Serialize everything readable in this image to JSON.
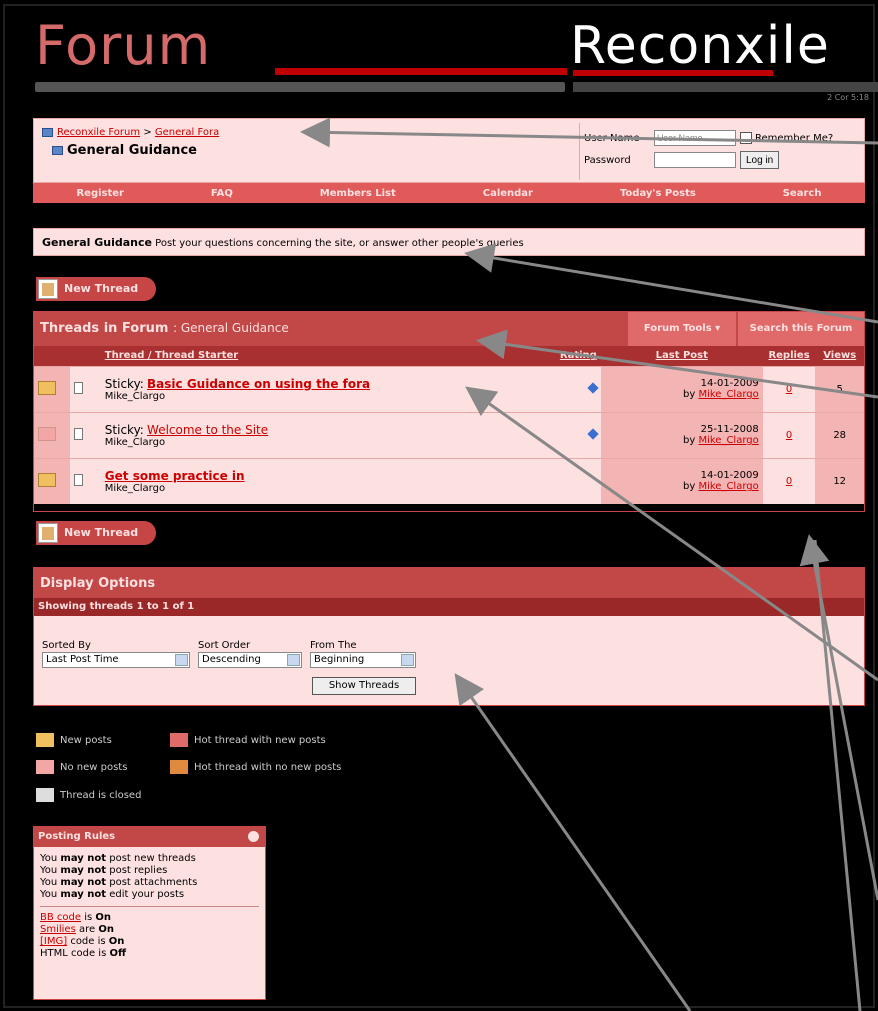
{
  "header": {
    "logo_left": "Forum",
    "logo_right": "Reconxile",
    "verse": "2 Cor 5:18"
  },
  "breadcrumb": {
    "root": "Reconxile Forum",
    "sep": ">",
    "parent": "General Fora",
    "current": "General Guidance"
  },
  "login": {
    "username_label": "User Name",
    "username_value": "User Name",
    "remember_label": "Remember Me?",
    "password_label": "Password",
    "login_button": "Log in"
  },
  "menu": [
    "Register",
    "FAQ",
    "Members List",
    "Calendar",
    "Today's Posts",
    "Search"
  ],
  "forum_desc": {
    "name": "General Guidance",
    "text": "Post your questions concerning the site, or answer other people's queries"
  },
  "new_thread_label": "New Thread",
  "threads": {
    "heading": "Threads in Forum",
    "forum_name": ": General Guidance",
    "tools": "Forum Tools ▾",
    "search": "Search this Forum",
    "columns": {
      "thread": "Thread",
      "slash": " / ",
      "starter": "Thread Starter",
      "rating": "Rating",
      "last_post": "Last Post",
      "replies": "Replies",
      "views": "Views"
    },
    "rows": [
      {
        "prefix": "Sticky:",
        "title": "Basic Guidance on using the fora",
        "starter": "Mike_Clargo",
        "date": "14-01-2009",
        "by": "by",
        "by_user": "Mike_Clargo",
        "replies": "0",
        "views": "5"
      },
      {
        "prefix": "Sticky:",
        "title": "Welcome to the Site",
        "starter": "Mike_Clargo",
        "date": "25-11-2008",
        "by": "by",
        "by_user": "Mike_Clargo",
        "replies": "0",
        "views": "28"
      },
      {
        "prefix": "",
        "title": "Get some practice in",
        "starter": "Mike_Clargo",
        "date": "14-01-2009",
        "by": "by",
        "by_user": "Mike_Clargo",
        "replies": "0",
        "views": "12"
      }
    ]
  },
  "display_options": {
    "heading": "Display Options",
    "showing": "Showing threads 1 to 1 of 1",
    "sorted_by_label": "Sorted By",
    "sorted_by_value": "Last Post Time",
    "sort_order_label": "Sort Order",
    "sort_order_value": "Descending",
    "from_label": "From The",
    "from_value": "Beginning",
    "show_button": "Show Threads"
  },
  "legend": {
    "new_posts": "New posts",
    "hot_new": "Hot thread with new posts",
    "no_new": "No new posts",
    "hot_no_new": "Hot thread with no new posts",
    "closed": "Thread is closed"
  },
  "posting_rules": {
    "heading": "Posting Rules",
    "lines": [
      {
        "a": "You ",
        "b": "may not",
        "c": " post new threads"
      },
      {
        "a": "You ",
        "b": "may not",
        "c": " post replies"
      },
      {
        "a": "You ",
        "b": "may not",
        "c": " post attachments"
      },
      {
        "a": "You ",
        "b": "may not",
        "c": " edit your posts"
      }
    ],
    "bb_link": "BB code",
    "bb_text": " is ",
    "bb_state": "On",
    "smilies_link": "Smilies",
    "smilies_text": " are ",
    "smilies_state": "On",
    "img_link": "[IMG]",
    "img_text": " code is ",
    "img_state": "On",
    "html_text": "HTML code is ",
    "html_state": "Off"
  },
  "colors": {
    "accent": "#c24848",
    "panel": "#fde0e0",
    "link": "#cc0000"
  }
}
